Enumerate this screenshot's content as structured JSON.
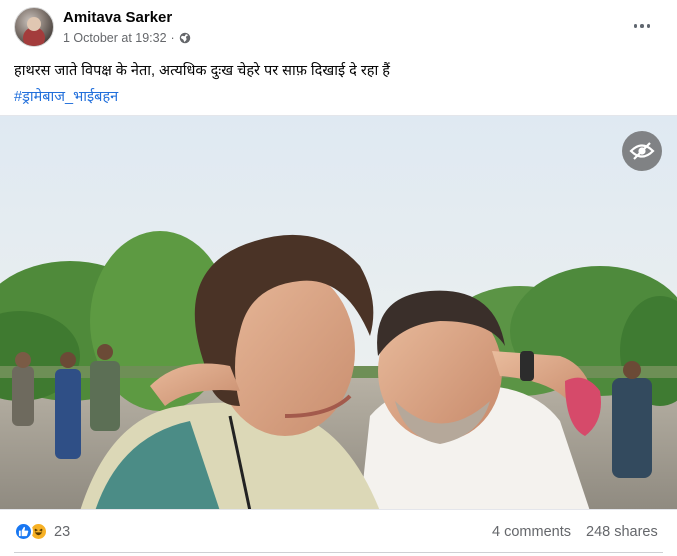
{
  "post": {
    "author": "Amitava Sarker",
    "timestamp": "1 October at 19:32",
    "separator": "·",
    "audience_icon": "globe-icon",
    "more_icon": "more-horizontal-icon",
    "text": "हाथरस जाते विपक्ष के नेता, अत्यधिक दुःख चेहरे पर साफ़ दिखाई दे रहा हैं",
    "hashtag": "#ड्रामेबाज_भाईबहन"
  },
  "photo": {
    "overlay_icon": "eye-slash-icon"
  },
  "footer": {
    "reaction_icons": [
      "like-icon",
      "haha-icon"
    ],
    "reaction_count": "23",
    "comments": "4 comments",
    "shares": "248 shares"
  },
  "colors": {
    "link": "#216fdb",
    "secondary_text": "#65676b",
    "like_blue": "#1877f2",
    "haha_yellow": "#f7b125"
  }
}
